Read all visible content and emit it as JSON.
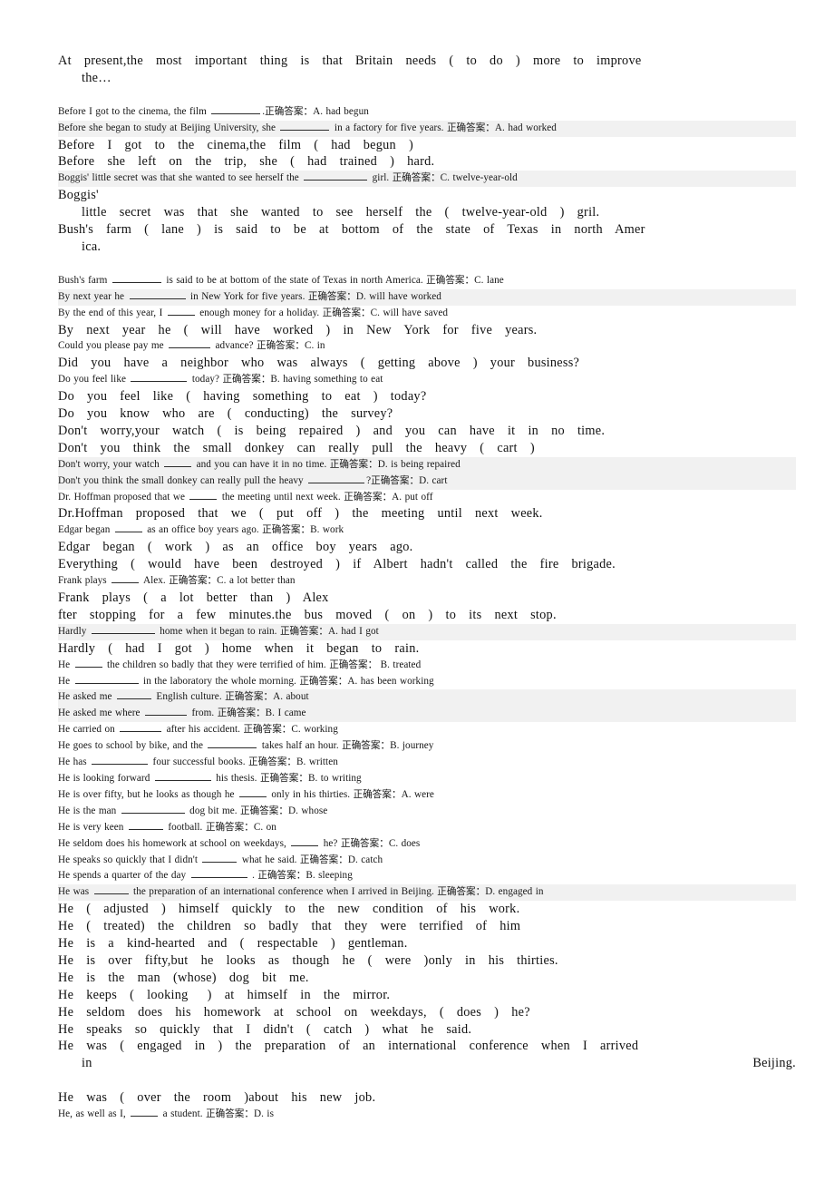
{
  "document": {
    "title": "English Grammar Exercise Answer Sheet",
    "answer_label": "正确答案：",
    "colors": {
      "page_background": "#ffffff",
      "text": "#111111",
      "highlight_band": "#f1f1f1",
      "blank_rule": "#2b2b2b"
    }
  },
  "lines": [
    {
      "id": "l01",
      "style": "big",
      "wrapped": true,
      "text": "At  present,the  most  important  thing  is  that  Britain  needs  (  to  do  )  more  to  improve",
      "continuation": "the…"
    },
    {
      "id": "l02",
      "style": "small",
      "band": false,
      "prefix": "Before I got to the cinema, the film ",
      "blank": "b7",
      "suffix": ".正确答案：A. had begun"
    },
    {
      "id": "l03",
      "style": "small",
      "band": true,
      "prefix": "Before she began to study at Beijing University, she ",
      "blank": "b7",
      "suffix": " in a factory for five years. 正确答案：A. had worked"
    },
    {
      "id": "l04",
      "style": "big",
      "text": "Before  I  got  to  the  cinema,the  film  (  had  begun  )"
    },
    {
      "id": "l05",
      "style": "big",
      "text": "Before  she  left  on  the  trip,  she  (  had  trained  )  hard."
    },
    {
      "id": "l06",
      "style": "small",
      "band": true,
      "prefix": "Boggis' little secret was that she wanted to see herself the ",
      "blank": "b9",
      "suffix": " girl. 正确答案：C. twelve-year-old"
    },
    {
      "id": "l07",
      "style": "big",
      "text": "Boggis'"
    },
    {
      "id": "l08",
      "style": "big",
      "indent": true,
      "text": "little  secret  was  that  she  wanted  to  see  herself  the  (  twelve-year-old  )  gril."
    },
    {
      "id": "l09",
      "style": "big",
      "wrapped": true,
      "text": "Bush's  farm  (  lane  )  is  said  to  be  at  bottom  of  the  state  of  Texas  in  north  Amer",
      "continuation": "ica."
    },
    {
      "id": "l10",
      "style": "small",
      "band": false,
      "prefix": "Bush's farm ",
      "blank": "b7",
      "suffix": " is said to be at bottom of the state of Texas in north America. 正确答案：C. lane"
    },
    {
      "id": "l11",
      "style": "small",
      "band": true,
      "prefix": "By next year he ",
      "blank": "b8",
      "suffix": " in New York for five years. 正确答案：D. will have worked"
    },
    {
      "id": "l12",
      "style": "small",
      "band": false,
      "prefix": "By the end of this year, I ",
      "blank": "b4",
      "suffix": " enough money for a holiday. 正确答案：C. will have saved"
    },
    {
      "id": "l13",
      "style": "big",
      "text": "By  next  year  he  (  will  have  worked  )  in  New  York  for  five  years."
    },
    {
      "id": "l14",
      "style": "small",
      "band": false,
      "prefix": "Could you please pay me ",
      "blank": "b6",
      "suffix": " advance? 正确答案：C. in"
    },
    {
      "id": "l15",
      "style": "big",
      "text": "Did  you  have  a  neighbor  who  was  always  (  getting  above  )  your  business?"
    },
    {
      "id": "l16",
      "style": "small",
      "band": false,
      "prefix": "Do you feel like ",
      "blank": "b8",
      "suffix": " today? 正确答案：B. having something to eat"
    },
    {
      "id": "l17",
      "style": "big",
      "text": "Do  you  feel  like  (  having  something  to  eat  )  today?"
    },
    {
      "id": "l18",
      "style": "big",
      "text": "Do  you  know  who  are  (  conducting)  the  survey?"
    },
    {
      "id": "l19",
      "style": "big",
      "text": "Don't  worry,your  watch  (  is  being  repaired  )  and  you  can  have  it  in  no  time."
    },
    {
      "id": "l20",
      "style": "big",
      "text": "Don't  you  think  the  small  donkey  can  really  pull  the  heavy  (  cart  )"
    },
    {
      "id": "l21",
      "style": "small",
      "band": true,
      "prefix": "Don't worry, your watch ",
      "blank": "b4",
      "suffix": " and you can have it in no time. 正确答案：D. is being repaired"
    },
    {
      "id": "l22",
      "style": "small",
      "band": true,
      "prefix": "Don't you think the small donkey can really pull the heavy ",
      "blank": "b8",
      "suffix": "?正确答案：D. cart"
    },
    {
      "id": "l23",
      "style": "small",
      "band": false,
      "prefix": "Dr. Hoffman proposed that we ",
      "blank": "b4",
      "suffix": " the meeting until next week. 正确答案：A. put off"
    },
    {
      "id": "l24",
      "style": "big",
      "text": "Dr.Hoffman  proposed  that  we  (  put  off  )  the  meeting  until  next  week."
    },
    {
      "id": "l25",
      "style": "small",
      "band": false,
      "prefix": "Edgar began ",
      "blank": "b4",
      "suffix": " as an office boy years ago. 正确答案：B. work"
    },
    {
      "id": "l26",
      "style": "big",
      "text": "Edgar  began  (  work  )  as  an  office  boy  years  ago."
    },
    {
      "id": "l27",
      "style": "big",
      "text": "Everything  (  would  have  been  destroyed  )  if  Albert  hadn't  called  the  fire  brigade."
    },
    {
      "id": "l28",
      "style": "small",
      "band": false,
      "prefix": "Frank plays ",
      "blank": "b4",
      "suffix": " Alex. 正确答案：C. a lot better than"
    },
    {
      "id": "l29",
      "style": "big",
      "text": "Frank  plays  (  a  lot  better  than  )  Alex"
    },
    {
      "id": "l30",
      "style": "big",
      "text": "fter  stopping  for  a  few  minutes.the  bus  moved  (  on  )  to  its  next  stop."
    },
    {
      "id": "l31",
      "style": "small",
      "band": true,
      "prefix": "Hardly ",
      "blank": "b9",
      "suffix": " home when it began to rain. 正确答案：A. had I got"
    },
    {
      "id": "l32",
      "style": "big",
      "text": "Hardly  (  had  I  got  )  home  when  it  began  to  rain."
    },
    {
      "id": "l33",
      "style": "small",
      "band": false,
      "prefix": "He ",
      "blank": "b4",
      "suffix": " the children so badly that they were terrified of him. 正确答案： B. treated"
    },
    {
      "id": "l34",
      "style": "small",
      "band": false,
      "prefix": "He ",
      "blank": "b9",
      "suffix": " in the laboratory the whole morning. 正确答案：A. has been working"
    },
    {
      "id": "l35",
      "style": "small",
      "band": true,
      "prefix": "He asked me ",
      "blank": "b5",
      "suffix": " English culture. 正确答案：A. about"
    },
    {
      "id": "l36",
      "style": "small",
      "band": true,
      "prefix": "He asked me where ",
      "blank": "b6",
      "suffix": " from. 正确答案：B. I came"
    },
    {
      "id": "l37",
      "style": "small",
      "band": false,
      "prefix": "He carried on ",
      "blank": "b6",
      "suffix": " after his accident. 正确答案：C. working"
    },
    {
      "id": "l38",
      "style": "small",
      "band": false,
      "prefix": "He goes to school by bike, and the ",
      "blank": "b7",
      "suffix": " takes half an hour. 正确答案：B. journey"
    },
    {
      "id": "l39",
      "style": "small",
      "band": false,
      "prefix": "He has ",
      "blank": "b8",
      "suffix": " four successful books. 正确答案：B. written"
    },
    {
      "id": "l40",
      "style": "small",
      "band": false,
      "prefix": "He is looking forward ",
      "blank": "b8",
      "suffix": " his thesis. 正确答案：B. to writing"
    },
    {
      "id": "l41",
      "style": "small",
      "band": false,
      "prefix": "He is over fifty, but he looks as though he ",
      "blank": "b4",
      "suffix": " only in his thirties. 正确答案：A. were"
    },
    {
      "id": "l42",
      "style": "small",
      "band": false,
      "prefix": "He is the man ",
      "blank": "b9",
      "suffix": " dog bit me. 正确答案：D. whose"
    },
    {
      "id": "l43",
      "style": "small",
      "band": false,
      "prefix": "He is very keen ",
      "blank": "b5",
      "suffix": " football. 正确答案：C. on"
    },
    {
      "id": "l44",
      "style": "small",
      "band": false,
      "prefix": "He seldom does his homework at school on weekdays, ",
      "blank": "b4",
      "suffix": " he? 正确答案：C. does"
    },
    {
      "id": "l45",
      "style": "small",
      "band": false,
      "prefix": "He speaks so quickly that I didn't ",
      "blank": "b5",
      "suffix": " what he said. 正确答案：D. catch"
    },
    {
      "id": "l46",
      "style": "small",
      "band": false,
      "prefix": "He spends a quarter of the day ",
      "blank": "b8",
      "suffix": " . 正确答案：B. sleeping"
    },
    {
      "id": "l47",
      "style": "small",
      "band": true,
      "prefix": "He was ",
      "blank": "b5",
      "suffix": " the preparation of an international conference when I arrived in Beijing. 正确答案：D. engaged in"
    },
    {
      "id": "l48",
      "style": "big",
      "text": "He  (  adjusted  )  himself  quickly  to  the  new  condition  of  his  work."
    },
    {
      "id": "l49",
      "style": "big",
      "text": "He  (  treated)  the  children  so  badly  that  they  were  terrified  of  him"
    },
    {
      "id": "l50",
      "style": "big",
      "text": "He  is  a  kind-hearted  and  (  respectable  )  gentleman."
    },
    {
      "id": "l51",
      "style": "big",
      "text": "He  is  over  fifty,but  he  looks  as  though  he  (  were  )only  in  his  thirties."
    },
    {
      "id": "l52",
      "style": "big",
      "text": "He  is  the  man  (whose)  dog  bit  me."
    },
    {
      "id": "l53",
      "style": "big",
      "text": "He  keeps  (  looking   )  at  himself  in  the  mirror."
    },
    {
      "id": "l54",
      "style": "big",
      "text": "He  seldom  does  his  homework  at  school  on  weekdays,  (  does  )  he?"
    },
    {
      "id": "l55",
      "style": "big",
      "text": "He  speaks  so  quickly  that  I  didn't  (  catch  )  what  he  said."
    },
    {
      "id": "l56",
      "style": "big",
      "wrapped": true,
      "text": "He  was  (  engaged  in  )  the  preparation  of  an  international  conference  when  I  arrived",
      "continuation": "in  Beijing."
    },
    {
      "id": "l57",
      "style": "big",
      "text": "He  was  (  over  the  room  )about  his  new  job."
    },
    {
      "id": "l58",
      "style": "small",
      "band": false,
      "prefix": "He, as well as I, ",
      "blank": "b4",
      "suffix": " a student. 正确答案：D. is"
    }
  ]
}
